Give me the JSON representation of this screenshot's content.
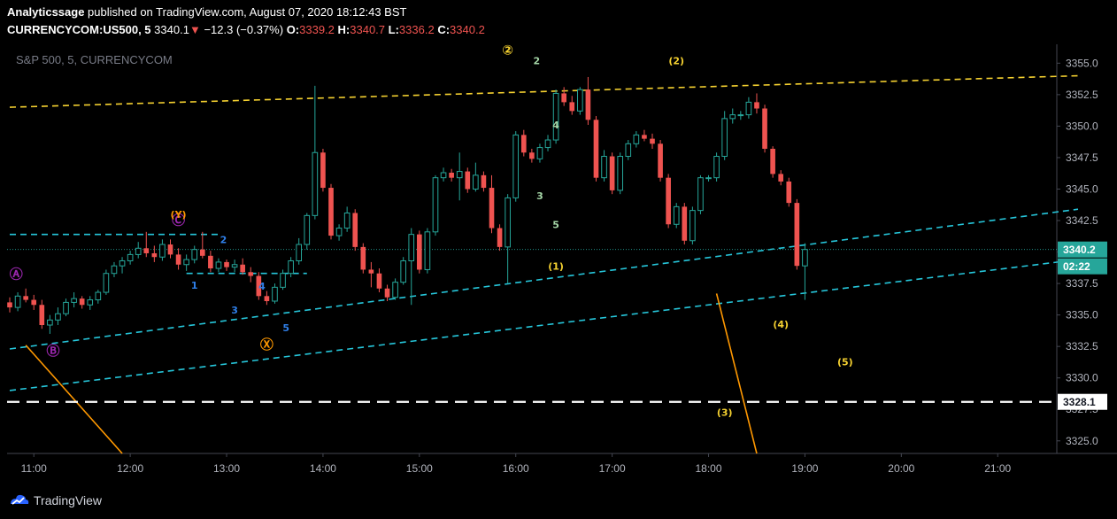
{
  "header": {
    "author": "Analyticssage",
    "published_text": " published on TradingView.com, August 07, 2020 18:12:43 BST",
    "symbol": "CURRENCYCOM:US500, 5",
    "last": "3340.1",
    "arrow": "▼",
    "change": "−12.3 (−0.37%)",
    "o_label": "O:",
    "o_value": "3339.2",
    "h_label": "H:",
    "h_value": "3340.7",
    "l_label": "L:",
    "l_value": "3336.2",
    "c_label": "C:",
    "c_value": "3340.2"
  },
  "chart_title": "S&P 500, 5, CURRENCYCOM",
  "brand": "TradingView",
  "colors": {
    "bull": "#26a69a",
    "bear": "#ef5350",
    "yellow": "#f5d130",
    "cyan": "#26c6da",
    "orange": "#ff9800",
    "purple": "#9c27b0",
    "blue": "#2f7fe8",
    "green_label": "#a5d6a7",
    "white": "#ffffff",
    "price_tag": "#26a69a"
  },
  "chart_data": {
    "type": "candlestick",
    "title": "S&P 500, 5, CURRENCYCOM",
    "x_ticks": [
      "11:00",
      "12:00",
      "13:00",
      "14:00",
      "15:00",
      "16:00",
      "17:00",
      "18:00",
      "19:00",
      "20:00",
      "21:00"
    ],
    "y_ticks": [
      3325.0,
      3327.5,
      3330.0,
      3332.5,
      3335.0,
      3337.5,
      3340.0,
      3342.5,
      3345.0,
      3347.5,
      3350.0,
      3352.5,
      3355.0
    ],
    "ylim": [
      3324.0,
      3356.5
    ],
    "time_start": "10:45",
    "bar_minutes": 5,
    "last_price_label": "3340.2",
    "countdown": "02:22",
    "level_label": "3328.1",
    "level_price": 3328.1,
    "ohlc": [
      [
        3336.0,
        3336.4,
        3335.2,
        3335.6
      ],
      [
        3335.6,
        3336.8,
        3335.3,
        3336.5
      ],
      [
        3336.5,
        3337.1,
        3336.0,
        3336.2
      ],
      [
        3336.2,
        3336.6,
        3335.4,
        3335.8
      ],
      [
        3335.8,
        3336.2,
        3333.9,
        3334.2
      ],
      [
        3334.2,
        3335.0,
        3333.5,
        3334.6
      ],
      [
        3334.6,
        3335.6,
        3334.2,
        3335.1
      ],
      [
        3335.1,
        3336.3,
        3334.9,
        3336.0
      ],
      [
        3336.0,
        3336.8,
        3335.6,
        3336.3
      ],
      [
        3336.3,
        3336.5,
        3335.5,
        3335.8
      ],
      [
        3335.8,
        3336.5,
        3335.4,
        3336.2
      ],
      [
        3336.2,
        3337.0,
        3335.9,
        3336.8
      ],
      [
        3336.8,
        3338.6,
        3336.6,
        3338.3
      ],
      [
        3338.3,
        3339.2,
        3338.0,
        3338.9
      ],
      [
        3338.9,
        3339.6,
        3338.3,
        3339.3
      ],
      [
        3339.3,
        3340.1,
        3339.0,
        3339.8
      ],
      [
        3339.8,
        3340.8,
        3339.5,
        3340.3
      ],
      [
        3340.3,
        3341.6,
        3339.6,
        3339.9
      ],
      [
        3339.9,
        3340.5,
        3339.2,
        3339.6
      ],
      [
        3339.6,
        3341.0,
        3339.3,
        3340.6
      ],
      [
        3340.6,
        3341.0,
        3339.5,
        3339.8
      ],
      [
        3339.8,
        3340.3,
        3338.6,
        3339.0
      ],
      [
        3339.0,
        3339.8,
        3338.5,
        3339.4
      ],
      [
        3339.4,
        3340.5,
        3339.1,
        3340.2
      ],
      [
        3340.2,
        3341.6,
        3339.5,
        3339.7
      ],
      [
        3339.7,
        3340.1,
        3338.4,
        3338.7
      ],
      [
        3338.7,
        3339.5,
        3338.4,
        3339.2
      ],
      [
        3339.2,
        3339.4,
        3338.5,
        3338.8
      ],
      [
        3338.8,
        3339.4,
        3338.4,
        3339.0
      ],
      [
        3339.0,
        3339.5,
        3338.2,
        3338.4
      ],
      [
        3338.4,
        3338.8,
        3337.6,
        3338.1
      ],
      [
        3338.1,
        3338.4,
        3336.2,
        3336.5
      ],
      [
        3336.5,
        3336.9,
        3335.8,
        3336.1
      ],
      [
        3336.1,
        3337.5,
        3335.9,
        3337.2
      ],
      [
        3337.2,
        3338.6,
        3337.0,
        3338.3
      ],
      [
        3338.3,
        3339.6,
        3338.0,
        3339.3
      ],
      [
        3339.3,
        3341.1,
        3339.0,
        3340.6
      ],
      [
        3340.6,
        3343.1,
        3340.2,
        3342.9
      ],
      [
        3342.9,
        3353.2,
        3342.6,
        3347.9
      ],
      [
        3347.9,
        3348.2,
        3344.8,
        3345.1
      ],
      [
        3345.1,
        3345.4,
        3341.0,
        3341.3
      ],
      [
        3341.3,
        3342.2,
        3340.9,
        3341.9
      ],
      [
        3341.9,
        3343.6,
        3341.6,
        3343.1
      ],
      [
        3343.1,
        3343.4,
        3340.1,
        3340.4
      ],
      [
        3340.4,
        3340.7,
        3338.3,
        3338.6
      ],
      [
        3338.6,
        3339.2,
        3337.2,
        3338.3
      ],
      [
        3338.3,
        3338.7,
        3336.8,
        3337.1
      ],
      [
        3337.1,
        3337.4,
        3336.1,
        3336.4
      ],
      [
        3336.4,
        3337.9,
        3336.2,
        3337.6
      ],
      [
        3337.6,
        3339.6,
        3337.4,
        3339.3
      ],
      [
        3339.3,
        3341.9,
        3335.8,
        3341.4
      ],
      [
        3341.4,
        3341.7,
        3338.3,
        3338.6
      ],
      [
        3338.6,
        3341.9,
        3338.3,
        3341.6
      ],
      [
        3341.6,
        3346.1,
        3341.3,
        3345.9
      ],
      [
        3345.9,
        3346.7,
        3345.6,
        3346.3
      ],
      [
        3346.3,
        3346.6,
        3345.6,
        3345.9
      ],
      [
        3345.9,
        3347.9,
        3344.1,
        3346.4
      ],
      [
        3346.4,
        3346.7,
        3344.7,
        3345.0
      ],
      [
        3345.0,
        3347.1,
        3344.8,
        3346.1
      ],
      [
        3346.1,
        3346.4,
        3344.8,
        3345.1
      ],
      [
        3345.1,
        3346.1,
        3341.5,
        3341.9
      ],
      [
        3341.9,
        3342.2,
        3340.1,
        3340.4
      ],
      [
        3340.4,
        3344.6,
        3337.5,
        3344.3
      ],
      [
        3344.3,
        3349.6,
        3344.0,
        3349.3
      ],
      [
        3349.3,
        3349.7,
        3347.6,
        3347.9
      ],
      [
        3347.9,
        3348.2,
        3347.1,
        3347.4
      ],
      [
        3347.4,
        3348.6,
        3347.1,
        3348.3
      ],
      [
        3348.3,
        3349.3,
        3348.0,
        3348.9
      ],
      [
        3348.9,
        3352.9,
        3348.6,
        3352.6
      ],
      [
        3352.6,
        3353.1,
        3351.6,
        3351.9
      ],
      [
        3351.9,
        3352.4,
        3350.9,
        3351.2
      ],
      [
        3351.2,
        3353.1,
        3350.9,
        3352.9
      ],
      [
        3352.9,
        3353.9,
        3350.1,
        3350.5
      ],
      [
        3350.5,
        3350.8,
        3345.6,
        3345.9
      ],
      [
        3345.9,
        3348.1,
        3345.6,
        3347.6
      ],
      [
        3347.6,
        3347.9,
        3344.6,
        3344.9
      ],
      [
        3344.9,
        3347.9,
        3344.6,
        3347.6
      ],
      [
        3347.6,
        3348.9,
        3347.3,
        3348.6
      ],
      [
        3348.6,
        3349.6,
        3348.3,
        3349.3
      ],
      [
        3349.3,
        3349.7,
        3348.8,
        3349.0
      ],
      [
        3349.0,
        3349.4,
        3348.2,
        3348.6
      ],
      [
        3348.6,
        3348.9,
        3345.6,
        3345.9
      ],
      [
        3345.9,
        3346.2,
        3341.9,
        3342.2
      ],
      [
        3342.2,
        3343.9,
        3341.9,
        3343.6
      ],
      [
        3343.6,
        3343.9,
        3340.6,
        3340.9
      ],
      [
        3340.9,
        3343.6,
        3340.6,
        3343.3
      ],
      [
        3343.3,
        3346.1,
        3343.0,
        3345.9
      ],
      [
        3345.9,
        3346.1,
        3345.6,
        3345.9
      ],
      [
        3345.9,
        3347.9,
        3345.6,
        3347.6
      ],
      [
        3347.6,
        3351.2,
        3347.3,
        3350.6
      ],
      [
        3350.6,
        3351.4,
        3350.2,
        3350.9
      ],
      [
        3350.9,
        3351.2,
        3350.5,
        3350.9
      ],
      [
        3350.9,
        3352.3,
        3350.6,
        3351.9
      ],
      [
        3351.9,
        3352.6,
        3351.0,
        3351.4
      ],
      [
        3351.4,
        3351.7,
        3347.9,
        3348.2
      ],
      [
        3348.2,
        3348.4,
        3345.9,
        3346.2
      ],
      [
        3346.2,
        3346.5,
        3345.3,
        3345.6
      ],
      [
        3345.6,
        3345.9,
        3343.6,
        3343.9
      ],
      [
        3343.9,
        3344.2,
        3338.6,
        3338.9
      ],
      [
        3338.9,
        3340.7,
        3336.2,
        3340.2
      ]
    ],
    "lines": [
      {
        "name": "upper-yellow",
        "style": "dashed",
        "color": "yellow",
        "points": [
          [
            "10:45",
            3351.5
          ],
          [
            "21:50",
            3354.0
          ]
        ]
      },
      {
        "name": "cyan-upper",
        "style": "dashed",
        "color": "cyan",
        "points": [
          [
            "10:45",
            3332.3
          ],
          [
            "21:50",
            3343.4
          ]
        ]
      },
      {
        "name": "cyan-lower",
        "style": "dashed",
        "color": "cyan",
        "points": [
          [
            "10:45",
            3329.0
          ],
          [
            "21:50",
            3339.4
          ]
        ]
      },
      {
        "name": "cyan-short-high",
        "style": "dashed",
        "color": "cyan",
        "points": [
          [
            "10:45",
            3341.4
          ],
          [
            "12:55",
            3341.4
          ]
        ]
      },
      {
        "name": "cyan-short-low",
        "style": "dashed",
        "color": "cyan",
        "points": [
          [
            "12:35",
            3338.3
          ],
          [
            "13:50",
            3338.3
          ]
        ]
      },
      {
        "name": "orange-left",
        "style": "solid",
        "color": "orange",
        "points": [
          [
            "10:55",
            3332.6
          ],
          [
            "11:55",
            3324.0
          ]
        ]
      },
      {
        "name": "orange-right",
        "style": "solid",
        "color": "orange",
        "points": [
          [
            "18:05",
            3336.7
          ],
          [
            "18:30",
            3324.0
          ]
        ]
      }
    ],
    "annotations": [
      {
        "text": "Ⓐ",
        "t": "10:49",
        "p": 3337.9,
        "color": "purple"
      },
      {
        "text": "Ⓑ",
        "t": "11:12",
        "p": 3331.8,
        "color": "purple"
      },
      {
        "text": "Ⓒ",
        "t": "12:30",
        "p": 3342.2,
        "color": "purple"
      },
      {
        "text": "(Y)",
        "t": "12:30",
        "p": 3342.7,
        "color": "orange"
      },
      {
        "text": "Ⓧ",
        "t": "13:25",
        "p": 3332.3,
        "color": "orange"
      },
      {
        "text": "1",
        "t": "12:40",
        "p": 3337.1,
        "color": "blue"
      },
      {
        "text": "2",
        "t": "12:58",
        "p": 3340.7,
        "color": "blue"
      },
      {
        "text": "3",
        "t": "13:05",
        "p": 3335.1,
        "color": "blue"
      },
      {
        "text": "4",
        "t": "13:22",
        "p": 3337.0,
        "color": "blue"
      },
      {
        "text": "5",
        "t": "13:37",
        "p": 3333.7,
        "color": "blue"
      },
      {
        "text": "②",
        "t": "15:55",
        "p": 3355.7,
        "color": "yellow"
      },
      {
        "text": "2",
        "t": "16:13",
        "p": 3354.9,
        "color": "green_label"
      },
      {
        "text": "4",
        "t": "16:25",
        "p": 3349.8,
        "color": "green_label"
      },
      {
        "text": "3",
        "t": "16:15",
        "p": 3344.2,
        "color": "green_label"
      },
      {
        "text": "5",
        "t": "16:25",
        "p": 3341.9,
        "color": "green_label"
      },
      {
        "text": "(1)",
        "t": "16:25",
        "p": 3338.6,
        "color": "yellow"
      },
      {
        "text": "(2)",
        "t": "17:40",
        "p": 3354.9,
        "color": "yellow"
      },
      {
        "text": "(3)",
        "t": "18:10",
        "p": 3327.0,
        "color": "yellow"
      },
      {
        "text": "(4)",
        "t": "18:45",
        "p": 3334.0,
        "color": "yellow"
      },
      {
        "text": "(5)",
        "t": "19:25",
        "p": 3331.0,
        "color": "yellow"
      }
    ]
  }
}
